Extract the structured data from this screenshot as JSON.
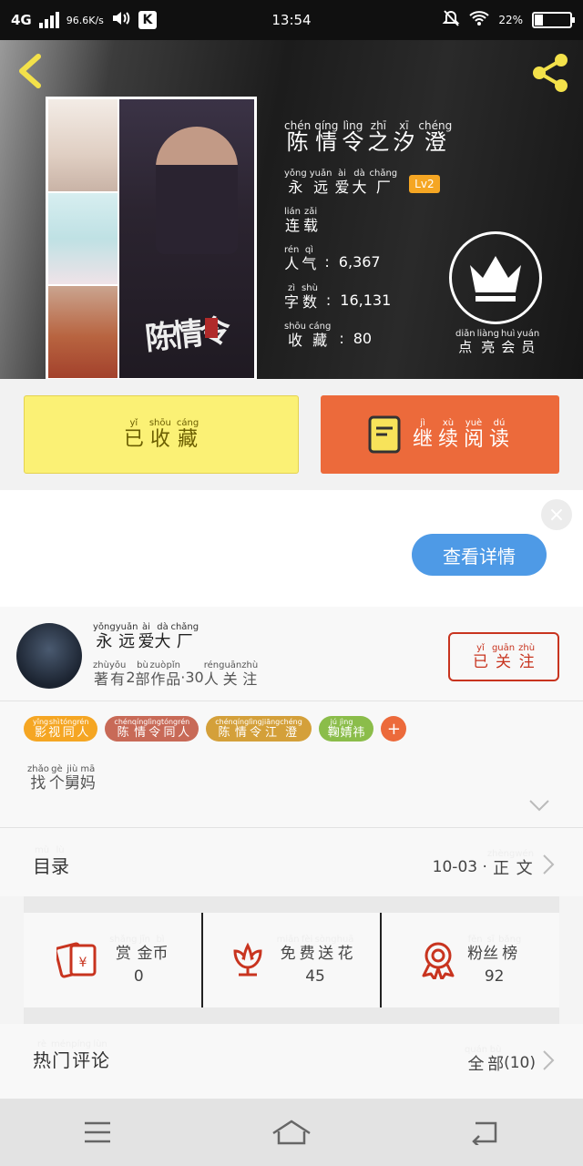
{
  "status": {
    "network": "4G",
    "speed": "96.6K/s",
    "time": "13:54",
    "battery": "22%"
  },
  "book": {
    "title": [
      [
        "chén",
        "陈"
      ],
      [
        "qíng",
        "情"
      ],
      [
        "lìng",
        "令"
      ],
      [
        "zhī",
        "之"
      ],
      [
        "xī",
        "汐"
      ],
      [
        "chéng",
        "澄"
      ]
    ],
    "author_label": [
      [
        "yǒng",
        "永"
      ],
      [
        "yuǎn",
        "远"
      ],
      [
        "ài",
        "爱"
      ],
      [
        "dà",
        "大"
      ],
      [
        "chǎng",
        "厂"
      ]
    ],
    "level": "Lv2",
    "status_label": [
      [
        "lián",
        "连"
      ],
      [
        "zǎi",
        "载"
      ]
    ],
    "popularity_label": [
      [
        "rén",
        "人"
      ],
      [
        "qì",
        "气"
      ]
    ],
    "popularity_value": "6,367",
    "word_count_label": [
      [
        "zì",
        "字"
      ],
      [
        "shù",
        "数"
      ]
    ],
    "word_count_value": "16,131",
    "favorites_label": [
      [
        "shōu",
        "收"
      ],
      [
        "cáng",
        "藏"
      ]
    ],
    "favorites_value": "80",
    "member_label": [
      [
        "diǎn",
        "点"
      ],
      [
        "liàng",
        "亮"
      ],
      [
        "huì",
        "会"
      ],
      [
        "yuán",
        "员"
      ]
    ],
    "cover_title": "陈情令"
  },
  "actions": {
    "favorited": [
      [
        "yǐ",
        "已"
      ],
      [
        "shōu",
        "收"
      ],
      [
        "cáng",
        "藏"
      ]
    ],
    "continue_reading": [
      [
        "jì",
        "继"
      ],
      [
        "xù",
        "续"
      ],
      [
        "yuè",
        "阅"
      ],
      [
        "dú",
        "读"
      ]
    ]
  },
  "ad": {
    "close": "×",
    "details_button": "查看详情"
  },
  "author": {
    "name": [
      [
        "yǒng",
        "永"
      ],
      [
        "yuǎn",
        "远"
      ],
      [
        "ài",
        "爱"
      ],
      [
        "dà",
        "大"
      ],
      [
        "chǎng",
        "厂"
      ]
    ],
    "works_prefix": [
      [
        "zhù",
        "著"
      ],
      [
        "yǒu",
        "有"
      ]
    ],
    "works_count": "2",
    "works_mid": [
      [
        "bù",
        "部"
      ],
      [
        "zuò",
        "作"
      ],
      [
        "pǐn",
        "品"
      ]
    ],
    "followers_count": "·30",
    "followers_suffix": [
      [
        "rén",
        "人"
      ],
      [
        "guān",
        "关"
      ],
      [
        "zhù",
        "注"
      ]
    ],
    "follow_button": [
      [
        "yǐ",
        "已"
      ],
      [
        "guān",
        "关"
      ],
      [
        "zhù",
        "注"
      ]
    ]
  },
  "tags": [
    {
      "color": "#f5a623",
      "chars": [
        [
          "yǐng",
          "影"
        ],
        [
          "shì",
          "视"
        ],
        [
          "tóng",
          "同"
        ],
        [
          "rén",
          "人"
        ]
      ]
    },
    {
      "color": "#c86a57",
      "chars": [
        [
          "chén",
          "陈"
        ],
        [
          "qíng",
          "情"
        ],
        [
          "lìng",
          "令"
        ],
        [
          "tóng",
          "同"
        ],
        [
          "rén",
          "人"
        ]
      ]
    },
    {
      "color": "#d4a03a",
      "chars": [
        [
          "chén",
          "陈"
        ],
        [
          "qíng",
          "情"
        ],
        [
          "lìng",
          "令"
        ],
        [
          "jiāng",
          "江"
        ],
        [
          "chéng",
          "澄"
        ]
      ]
    },
    {
      "color": "#8bbd4a",
      "chars": [
        [
          "jú",
          "鞠"
        ],
        [
          "jìng",
          "婧"
        ],
        [
          "",
          "祎"
        ]
      ]
    }
  ],
  "description": [
    [
      "zhǎo",
      "找"
    ],
    [
      "gè",
      "个"
    ],
    [
      "jiù",
      "舅"
    ],
    [
      "mā",
      "妈"
    ]
  ],
  "toc": {
    "label": [
      [
        "mù",
        "目"
      ],
      [
        "lù",
        "录"
      ]
    ],
    "date": "10-03 ·",
    "type": [
      [
        "zhèng",
        "正"
      ],
      [
        "wén",
        "文"
      ]
    ]
  },
  "stats": [
    {
      "icon": "red-envelope-icon",
      "label": [
        [
          "shǎng",
          "赏"
        ],
        [
          "jīn",
          "金"
        ],
        [
          "bì",
          "币"
        ]
      ],
      "value": "0"
    },
    {
      "icon": "flower-icon",
      "label": [
        [
          "miǎn",
          "免"
        ],
        [
          "fèi",
          "费"
        ],
        [
          "sòng",
          "送"
        ],
        [
          "huā",
          "花"
        ]
      ],
      "value": "45"
    },
    {
      "icon": "medal-icon",
      "label": [
        [
          "fěn",
          "粉"
        ],
        [
          "sī",
          "丝"
        ],
        [
          "bǎng",
          "榜"
        ]
      ],
      "value": "92"
    }
  ],
  "comments": {
    "label": [
      [
        "rè",
        "热"
      ],
      [
        "mén",
        "门"
      ],
      [
        "píng",
        "评"
      ],
      [
        "lùn",
        "论"
      ]
    ],
    "all": [
      [
        "quán",
        "全"
      ],
      [
        "bù",
        "部"
      ]
    ],
    "count": "(10)"
  },
  "colors": {
    "accent_orange": "#ec6a3b",
    "fav_yellow": "#fbf175",
    "follow_red": "#c8341f",
    "ad_blue": "#4e9ae6",
    "level_badge": "#f5a623"
  }
}
